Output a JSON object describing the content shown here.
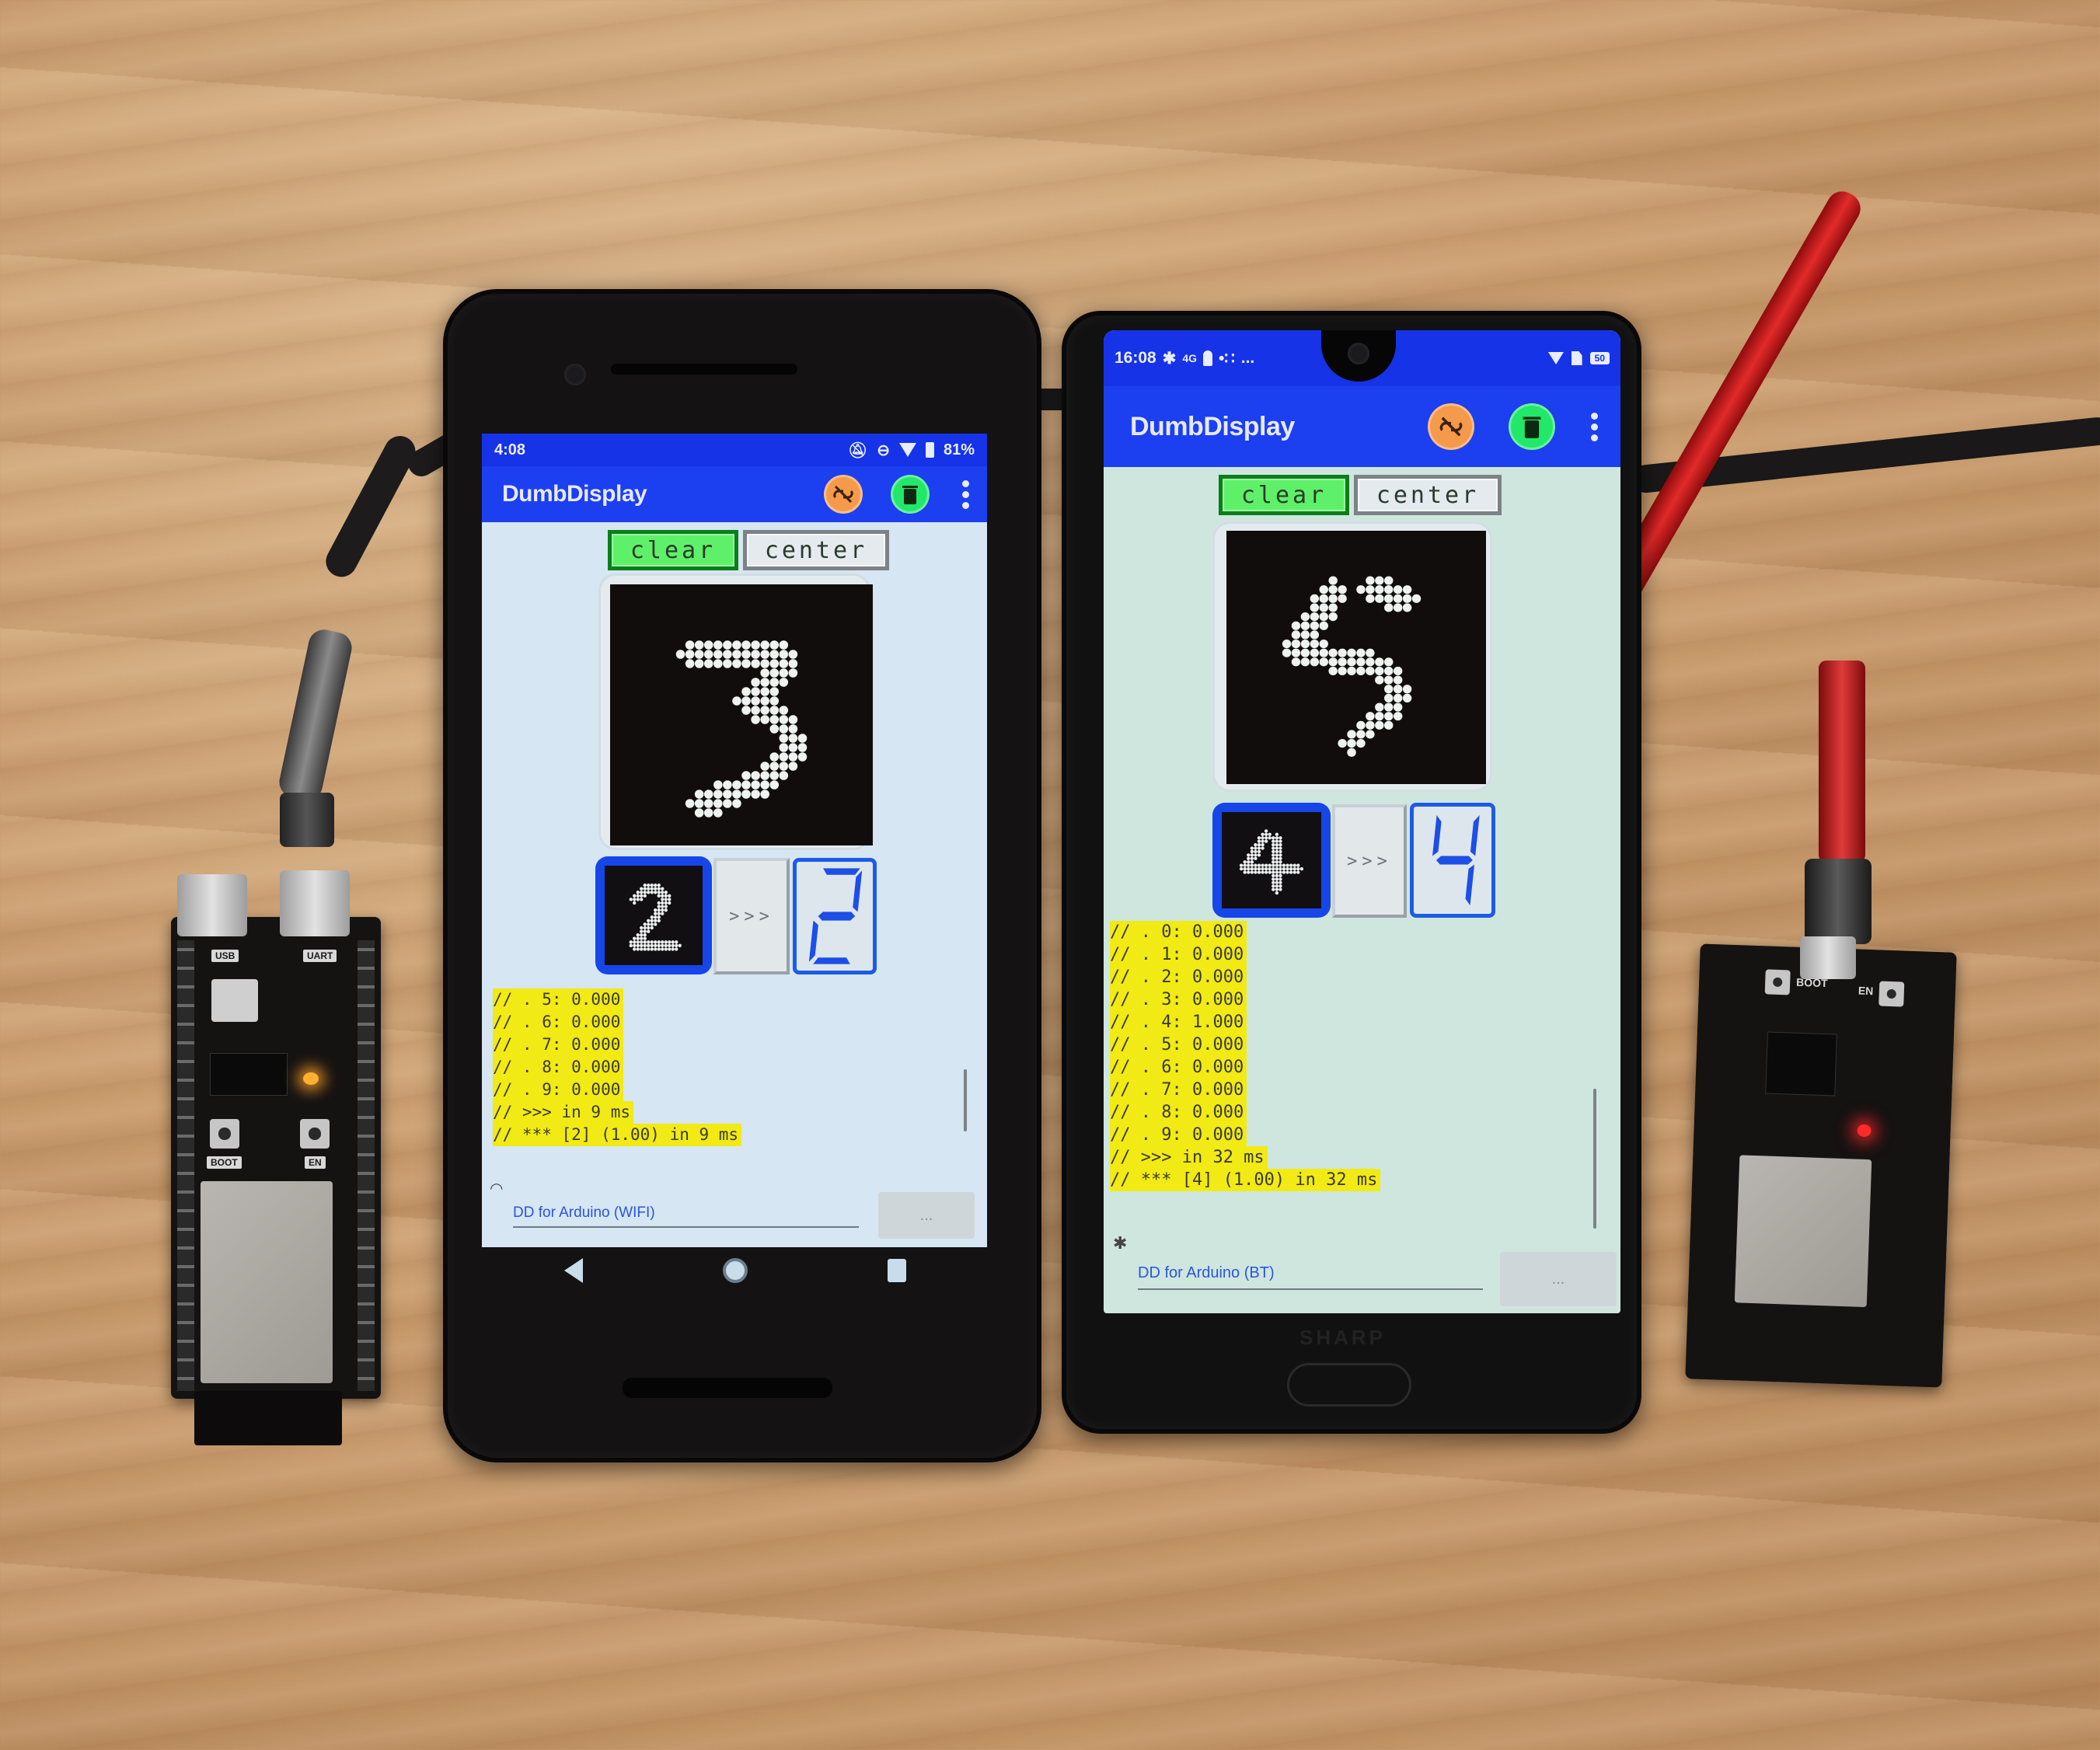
{
  "scene": {
    "description_type": "photo of two Android phones running DumbDisplay connected to two ESP32 boards"
  },
  "left_phone": {
    "status_bar": {
      "time": "4:08",
      "icons": [
        "notifications-off-icon",
        "do-not-disturb-icon",
        "wifi-icon",
        "battery-icon"
      ],
      "battery": "81%"
    },
    "app_bar": {
      "title": "DumbDisplay",
      "actions": [
        "unlink-icon",
        "trash-icon",
        "more-vert-icon"
      ]
    },
    "buttons": {
      "clear": "clear",
      "center": "center"
    },
    "drawn_digit": "3",
    "result": {
      "thumbnail_digit": "2",
      "arrow": ">>>",
      "seven_segment_digit": "2"
    },
    "log_lines": [
      "// . 5: 0.000",
      "// . 6: 0.000",
      "// . 7: 0.000",
      "// . 8: 0.000",
      "// . 9: 0.000",
      "// >>> in 9 ms",
      "// *** [2] (1.00) in 9 ms"
    ],
    "connection": {
      "icon": "wifi-icon",
      "name": "DD for Arduino (WIFI)",
      "button": "..."
    },
    "nav": [
      "back-icon",
      "home-icon",
      "recents-icon"
    ]
  },
  "right_phone": {
    "status_bar": {
      "time": "16:08",
      "left_icons": [
        "bluetooth-icon",
        "hd-volte-icon",
        "keyhole-icon",
        "assistant-icon"
      ],
      "overflow": "...",
      "right_icons": [
        "wifi-icon",
        "no-sim-icon"
      ],
      "battery": "50"
    },
    "app_bar": {
      "title": "DumbDisplay",
      "actions": [
        "unlink-icon",
        "trash-icon",
        "more-vert-icon"
      ]
    },
    "buttons": {
      "clear": "clear",
      "center": "center"
    },
    "drawn_digit": "5",
    "result": {
      "thumbnail_digit": "4",
      "arrow": ">>>",
      "seven_segment_digit": "4"
    },
    "log_lines": [
      "// . 0: 0.000",
      "// . 1: 0.000",
      "// . 2: 0.000",
      "// . 3: 0.000",
      "// . 4: 1.000",
      "// . 5: 0.000",
      "// . 6: 0.000",
      "// . 7: 0.000",
      "// . 8: 0.000",
      "// . 9: 0.000",
      "// >>> in 32 ms",
      "// *** [4] (1.00) in 32 ms"
    ],
    "connection": {
      "icon": "bluetooth-icon",
      "name": "DD for Arduino (BT)",
      "button": "..."
    },
    "brand": "SHARP"
  },
  "left_board": {
    "labels": [
      "USB",
      "UART",
      "BOOT",
      "EN"
    ]
  },
  "right_board": {
    "labels": [
      "BOOT",
      "EN"
    ]
  },
  "colors": {
    "app_bar": "#1c3ff0",
    "clear_button": "#5ff06a",
    "center_button": "#e4eaee",
    "unlink_button": "#f59a4a",
    "trash_button": "#22e86a",
    "log_highlight": "#f2ea14",
    "seven_segment": "#1d4fe6",
    "connection_text": "#2b55d8"
  }
}
